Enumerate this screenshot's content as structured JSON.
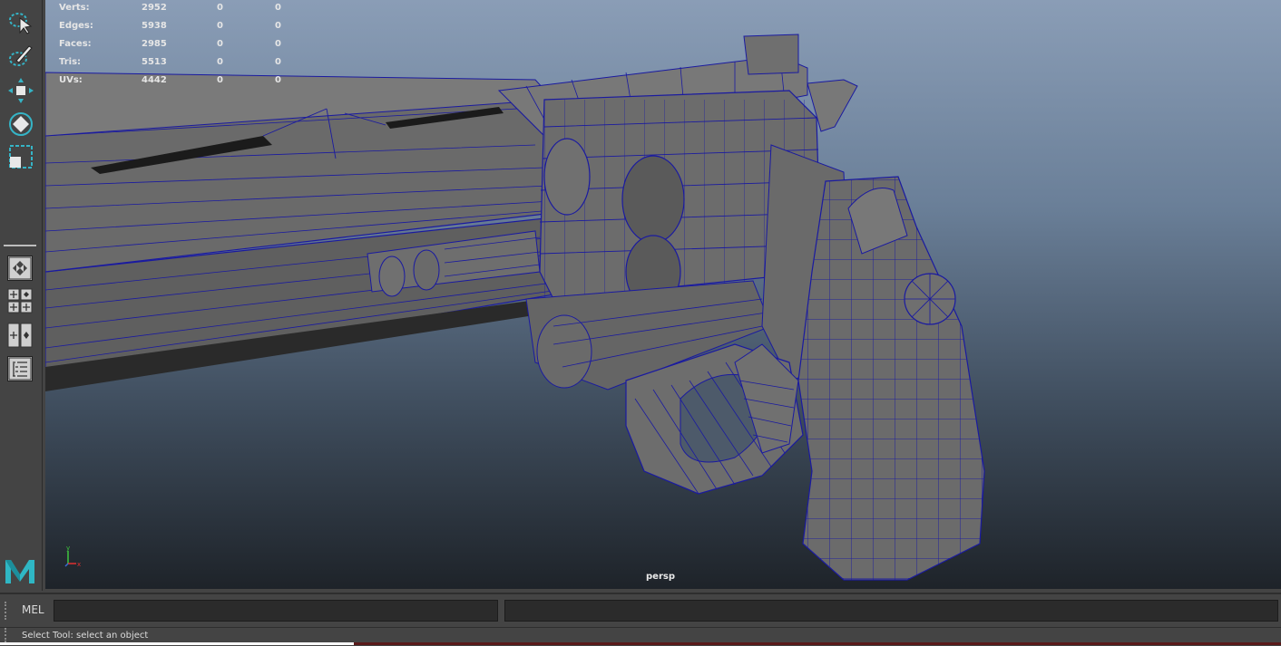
{
  "hud": {
    "rows": [
      {
        "label": "Verts:",
        "v1": "2952",
        "v2": "0",
        "v3": "0"
      },
      {
        "label": "Edges:",
        "v1": "5938",
        "v2": "0",
        "v3": "0"
      },
      {
        "label": "Faces:",
        "v1": "2985",
        "v2": "0",
        "v3": "0"
      },
      {
        "label": "Tris:",
        "v1": "5513",
        "v2": "0",
        "v3": "0"
      },
      {
        "label": "UVs:",
        "v1": "4442",
        "v2": "0",
        "v3": "0"
      }
    ]
  },
  "viewport": {
    "camera": "persp",
    "axis": {
      "y": "y",
      "x": "x"
    }
  },
  "toolbox": {
    "tools": [
      "lasso-select-icon",
      "paint-select-icon",
      "move-tool-icon",
      "rotate-tool-icon",
      "scale-tool-icon"
    ],
    "layouts": [
      "single-pane-layout-icon",
      "four-pane-layout-icon",
      "two-pane-layout-icon",
      "outliner-layout-icon"
    ]
  },
  "command_line": {
    "label": "MEL",
    "input": "",
    "output": ""
  },
  "help_line": {
    "text": "Select Tool: select an object"
  },
  "colors": {
    "wire": "#1a1aa0",
    "mesh": "#6a6a6a",
    "accent": "#34b6c4"
  }
}
